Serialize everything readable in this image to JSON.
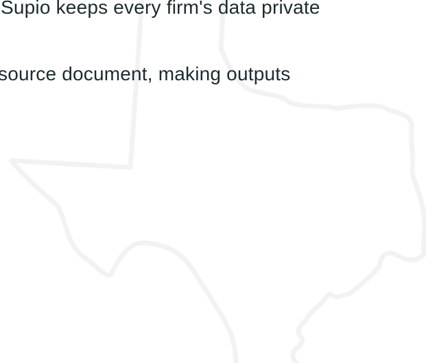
{
  "content": {
    "line_1": "Supio keeps every firm's data private",
    "line_2": "source document, making outputs"
  },
  "decoration": {
    "icon": "texas-state-outline-icon",
    "outline_color": "#f1f3f3"
  },
  "colors": {
    "text": "#1c2b2e",
    "background": "#ffffff"
  }
}
